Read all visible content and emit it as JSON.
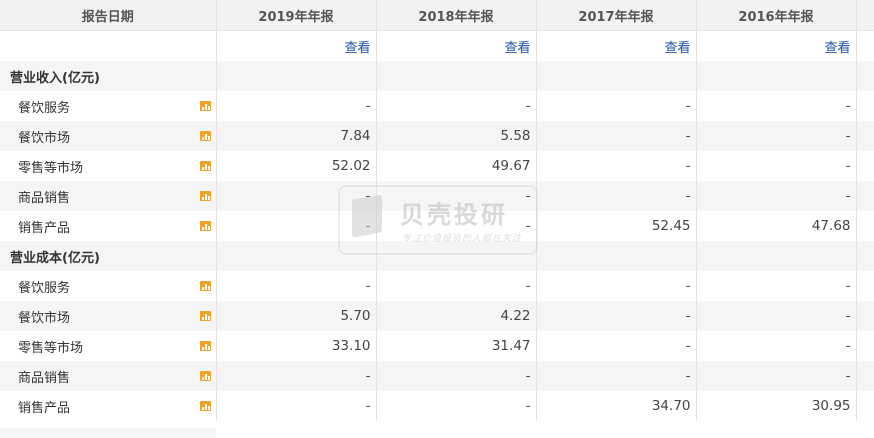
{
  "header": {
    "label": "报告日期",
    "years": [
      "2019年年报",
      "2018年年报",
      "2017年年报",
      "2016年年报"
    ]
  },
  "view_label": "查看",
  "sections": [
    {
      "title": "营业收入(亿元)",
      "rows": [
        {
          "label": "餐饮服务",
          "values": [
            "-",
            "-",
            "-",
            "-"
          ]
        },
        {
          "label": "餐饮市场",
          "values": [
            "7.84",
            "5.58",
            "-",
            "-"
          ]
        },
        {
          "label": "零售等市场",
          "values": [
            "52.02",
            "49.67",
            "-",
            "-"
          ]
        },
        {
          "label": "商品销售",
          "values": [
            "-",
            "-",
            "-",
            "-"
          ]
        },
        {
          "label": "销售产品",
          "values": [
            "-",
            "-",
            "52.45",
            "47.68"
          ]
        }
      ]
    },
    {
      "title": "营业成本(亿元)",
      "rows": [
        {
          "label": "餐饮服务",
          "values": [
            "-",
            "-",
            "-",
            "-"
          ]
        },
        {
          "label": "餐饮市场",
          "values": [
            "5.70",
            "4.22",
            "-",
            "-"
          ]
        },
        {
          "label": "零售等市场",
          "values": [
            "33.10",
            "31.47",
            "-",
            "-"
          ]
        },
        {
          "label": "商品销售",
          "values": [
            "-",
            "-",
            "-",
            "-"
          ]
        },
        {
          "label": "销售产品",
          "values": [
            "-",
            "-",
            "34.70",
            "30.95"
          ]
        }
      ]
    }
  ],
  "watermark": {
    "title": "贝壳投研",
    "subtitle": "专注价值投资的人都在关注"
  },
  "colors": {
    "link": "#1a4fa3",
    "chart_icon": "#f0a128",
    "header_bg": "#f2f2f2",
    "alt_row": "#f5f5f5"
  }
}
